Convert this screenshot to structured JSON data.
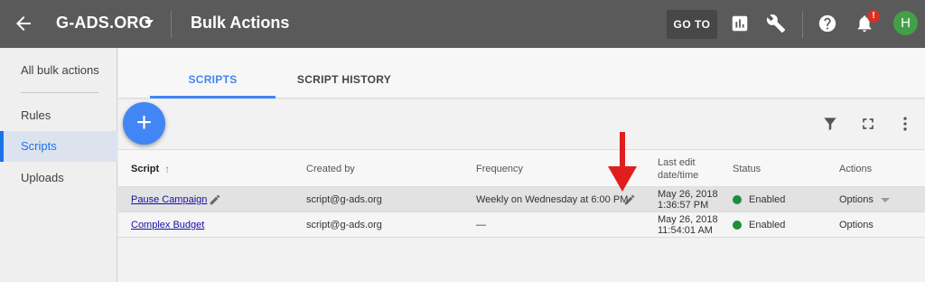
{
  "header": {
    "account": "G-ADS.ORG",
    "title": "Bulk Actions",
    "goto_label": "GO TO",
    "notification_badge": "!",
    "avatar_initial": "H"
  },
  "sidebar": {
    "items": [
      {
        "label": "All bulk actions"
      },
      {
        "label": "Rules"
      },
      {
        "label": "Scripts"
      },
      {
        "label": "Uploads"
      }
    ]
  },
  "tabs": [
    {
      "label": "SCRIPTS",
      "active": true
    },
    {
      "label": "SCRIPT HISTORY",
      "active": false
    }
  ],
  "fab": {
    "symbol": "+"
  },
  "table": {
    "columns": [
      "Script",
      "Created by",
      "Frequency",
      "Last edit date/time",
      "Status",
      "Actions"
    ],
    "rows": [
      {
        "script": "Pause Campaign",
        "created_by": "script@g-ads.org",
        "frequency": "Weekly on Wednesday at 6:00 PM",
        "last_edit_date": "May 26, 2018",
        "last_edit_time": "1:36:57 PM",
        "status": "Enabled",
        "actions": "Options"
      },
      {
        "script": "Complex Budget",
        "created_by": "script@g-ads.org",
        "frequency": "—",
        "last_edit_date": "May 26, 2018",
        "last_edit_time": "11:54:01 AM",
        "status": "Enabled",
        "actions": "Options"
      }
    ]
  },
  "colors": {
    "topbar": "#5a5a5a",
    "accent": "#4285f4",
    "status_enabled": "#1e8e3e",
    "alert": "#d93025",
    "annotation_arrow": "#e01e1e"
  },
  "icons": [
    "back-arrow-icon",
    "dropdown-caret-icon",
    "reports-icon",
    "tools-wrench-icon",
    "help-icon",
    "notifications-bell-icon",
    "sort-up-arrow-icon",
    "filter-icon",
    "fullscreen-icon",
    "more-vert-icon",
    "edit-pencil-icon"
  ]
}
